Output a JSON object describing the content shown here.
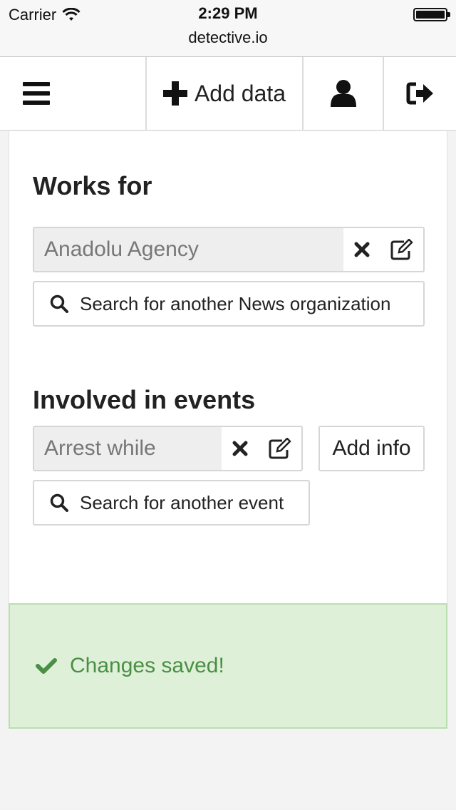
{
  "status_bar": {
    "carrier": "Carrier",
    "time": "2:29 PM",
    "url": "detective.io"
  },
  "navbar": {
    "menu_icon": "hamburger-icon",
    "add_label": "Add data",
    "user_icon": "user-icon",
    "logout_icon": "sign-out-icon"
  },
  "works_for": {
    "title": "Works for",
    "value": "Anadolu Agency",
    "search_label": "Search for another News organization"
  },
  "events": {
    "title": "Involved in events",
    "value": "Arrest while",
    "add_info_label": "Add info",
    "search_label": "Search for another event"
  },
  "alert": {
    "message": "Changes saved!",
    "color": "#4a8f45",
    "background": "#dff0d8"
  }
}
